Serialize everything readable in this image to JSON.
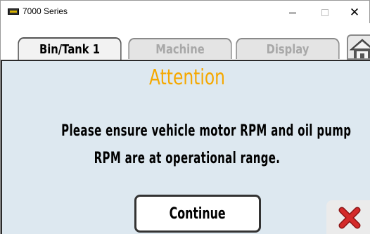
{
  "window": {
    "title": "7000 Series",
    "minimize_label": "–",
    "maximize_label": "☐",
    "close_label": "✕"
  },
  "tabs": [
    {
      "label": "Bin/Tank 1",
      "active": true
    },
    {
      "label": "Machine",
      "active": false
    },
    {
      "label": "Display",
      "active": false
    }
  ],
  "home": {
    "icon": "home-icon"
  },
  "dialog": {
    "heading": "Attention",
    "message_lines": [
      "Please ensure vehicle motor RPM and oil pump",
      "RPM are at operational range."
    ],
    "continue_label": "Continue",
    "cancel_icon": "red-x-icon"
  },
  "colors": {
    "heading": "#f5a800",
    "dialog_bg": "#dde8f0",
    "cancel_x": "#d42a2a"
  }
}
